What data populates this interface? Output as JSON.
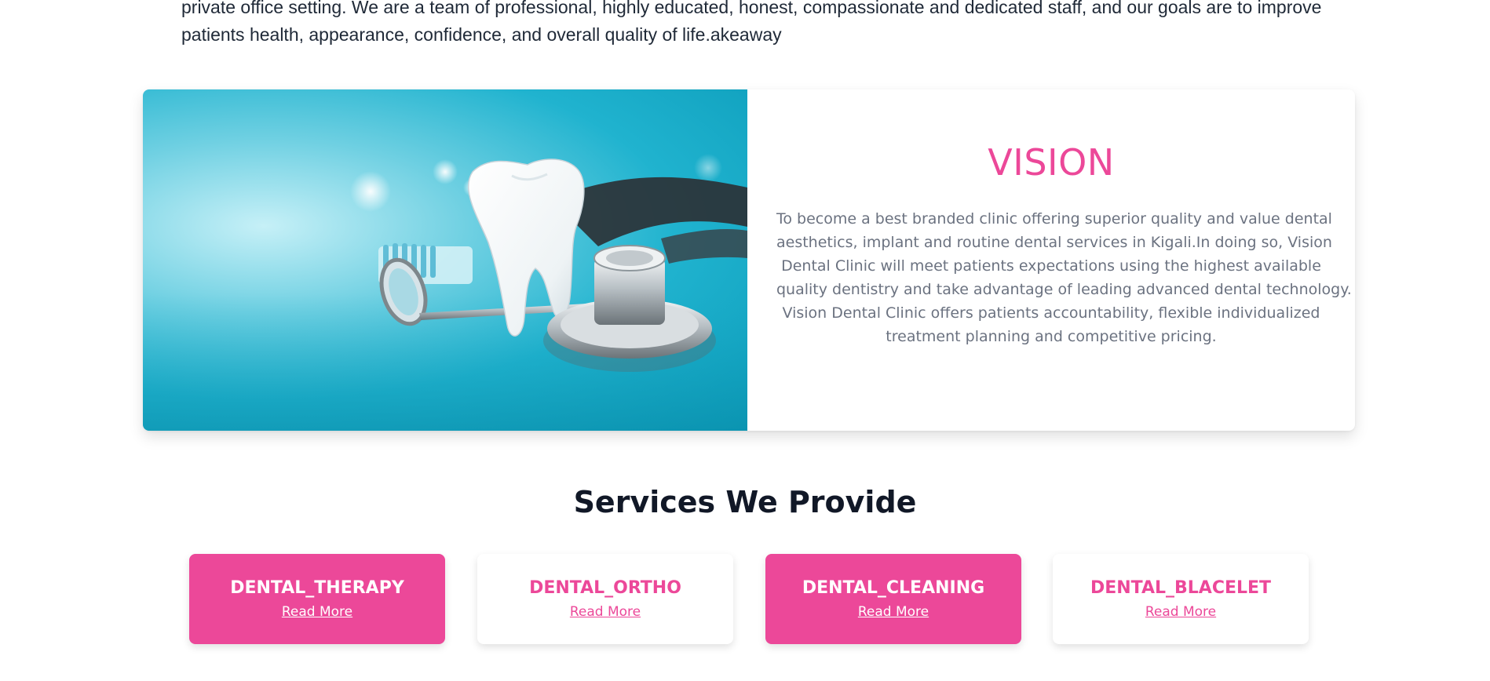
{
  "intro": {
    "line1": "private office setting. We are a team of professional, highly educated, honest, compassionate and dedicated staff, and our goals are to improve",
    "line2": "patients health, appearance, confidence, and overall quality of life.akeaway"
  },
  "vision": {
    "title": "VISION",
    "lines": [
      "To become a best branded clinic offering superior quality and value dental",
      "aesthetics, implant and routine dental services in Kigali.In doing so, Vision",
      "Dental Clinic will meet patients expectations using the highest available",
      "quality dentistry and take advantage of leading advanced dental technology.",
      "Vision Dental Clinic offers patients accountability, flexible individualized",
      "treatment planning and competitive pricing."
    ],
    "image": "dental-tools-photo"
  },
  "services": {
    "title": "Services We Provide",
    "items": [
      {
        "name": "DENTAL_THERAPY",
        "link": "Read More",
        "style": "filled"
      },
      {
        "name": "DENTAL_ORTHO",
        "link": "Read More",
        "style": "outline"
      },
      {
        "name": "DENTAL_CLEANING",
        "link": "Read More",
        "style": "filled"
      },
      {
        "name": "DENTAL_BLACELET",
        "link": "Read More",
        "style": "outline"
      }
    ]
  },
  "colors": {
    "accent": "#ec4899",
    "heading": "#111827",
    "body_text": "#6b7280"
  }
}
